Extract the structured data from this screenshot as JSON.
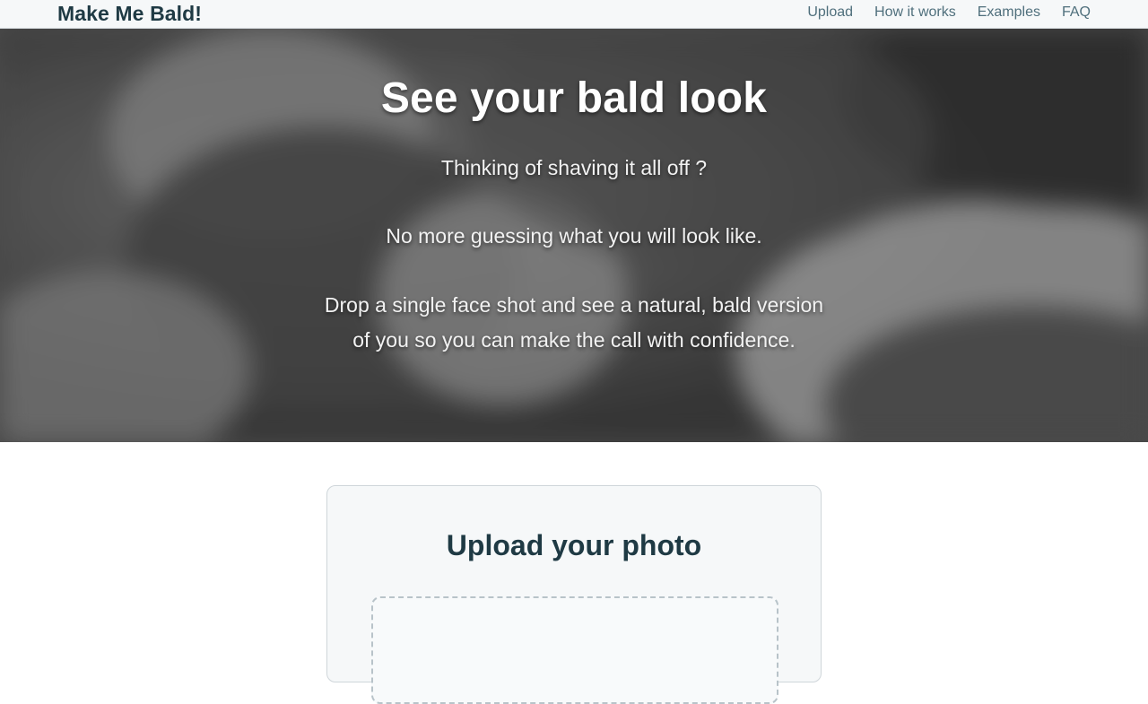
{
  "nav": {
    "brand": "Make Me Bald!",
    "links": [
      {
        "label": "Upload"
      },
      {
        "label": "How it works"
      },
      {
        "label": "Examples"
      },
      {
        "label": "FAQ"
      }
    ]
  },
  "hero": {
    "title": "See your bald look",
    "line1": "Thinking of shaving it all off ?",
    "line2": "No more guessing what you will look like.",
    "line3a": "Drop a single face shot and see a natural, bald version",
    "line3b": "of you so you can make the call with confidence."
  },
  "upload": {
    "title": "Upload your photo"
  },
  "colors": {
    "brand_text": "#1f3a44",
    "nav_link": "#4f6f7c",
    "nav_bg": "#f6f8f9",
    "card_bg": "#f6f8f9"
  }
}
